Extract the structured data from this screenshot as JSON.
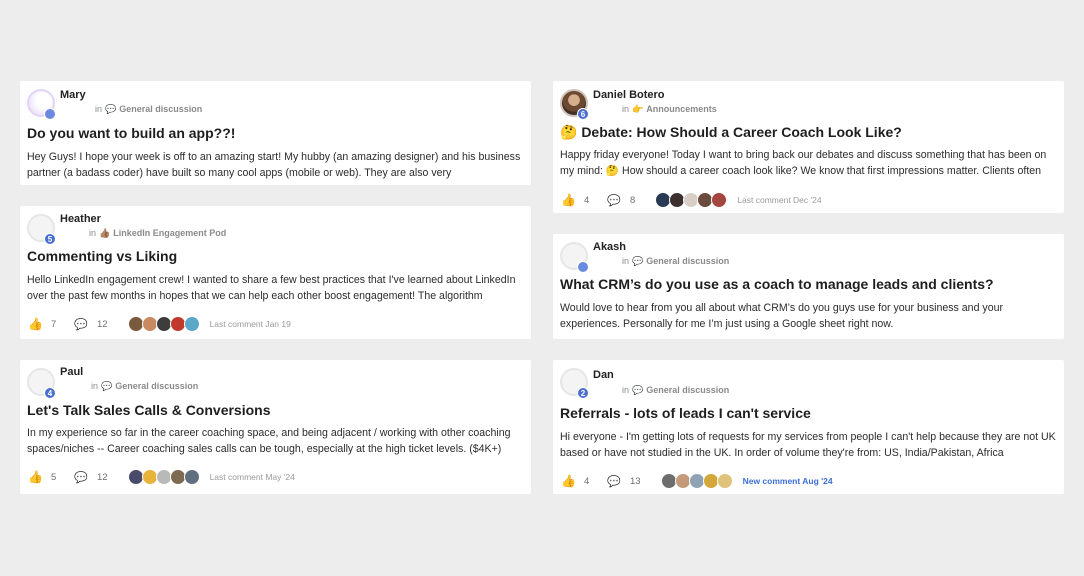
{
  "posts": [
    {
      "author": "Mary",
      "level": "",
      "space_prefix": "in",
      "space_icon": "💬",
      "space": "General discussion",
      "title": "Do you want to build an app??!",
      "excerpt": "Hey Guys! I hope your week is off to an amazing start! My hubby (an amazing designer) and his business partner (a badass coder) have built so many cool apps (mobile or web). They are also very"
    },
    {
      "author": "Heather",
      "level": "5",
      "space_prefix": "in",
      "space_icon": "👍🏽",
      "space": "LinkedIn Engagement Pod",
      "title": "Commenting vs Liking",
      "excerpt": "Hello LinkedIn engagement crew! I wanted to share a few best practices that I've learned about LinkedIn over the past few months in hopes that we can help each other boost engagement! The algorithm",
      "likes": "7",
      "comments": "12",
      "last_comment": "Last comment Jan 19",
      "participant_colors": [
        "#7a5a3c",
        "#c98a62",
        "#3d3d3d",
        "#c0392b",
        "#5aa7c9"
      ]
    },
    {
      "author": "Paul",
      "level": "4",
      "space_prefix": "in",
      "space_icon": "💬",
      "space": "General discussion",
      "title": "Let's Talk Sales Calls & Conversions",
      "excerpt": "In my experience so far in the career coaching space, and being adjacent / working with other coaching spaces/niches -- Career coaching sales calls can be tough, especially at the high ticket levels. ($4K+)",
      "likes": "5",
      "comments": "12",
      "last_comment": "Last comment May '24",
      "participant_colors": [
        "#4a4a6a",
        "#e8b33a",
        "#b9b9b9",
        "#7d6a4f",
        "#5f6f7f"
      ]
    },
    {
      "author": "Daniel Botero",
      "level": "6",
      "space_prefix": "in",
      "space_icon": "👉",
      "space": "Announcements",
      "title": "🤔 Debate: How Should a Career Coach Look Like?",
      "excerpt": "Happy friday everyone! Today I want to bring back our debates and discuss something that has been on my mind: 🤔 How should a career coach look like?  We know that first impressions matter. Clients often",
      "likes": "4",
      "comments": "8",
      "last_comment": "Last comment Dec '24",
      "participant_colors": [
        "#2a3a55",
        "#3b2f2f",
        "#d9cfc6",
        "#6b4b3e",
        "#a4463f"
      ]
    },
    {
      "author": "Akash",
      "level": "",
      "space_prefix": "in",
      "space_icon": "💬",
      "space": "General discussion",
      "title": "What CRM’s do you use as a coach to manage leads and clients?",
      "excerpt": "Would love to hear from you all about what CRM’s do you guys use for your business and your experiences. Personally for me I’m just using a Google sheet right now."
    },
    {
      "author": "Dan",
      "level": "2",
      "space_prefix": "in",
      "space_icon": "💬",
      "space": "General discussion",
      "title": "Referrals - lots of leads I can't service",
      "excerpt": "Hi everyone - I'm getting lots of requests for my services from people I can't help because they are not UK based or have not studied in the UK. In order of volume they're from: US, India/Pakistan, Africa",
      "likes": "4",
      "comments": "13",
      "last_comment": "New comment Aug '24",
      "participant_colors": [
        "#6d6d6d",
        "#c49a7b",
        "#8fa3b5",
        "#d4a73a",
        "#e0c27a"
      ]
    }
  ]
}
